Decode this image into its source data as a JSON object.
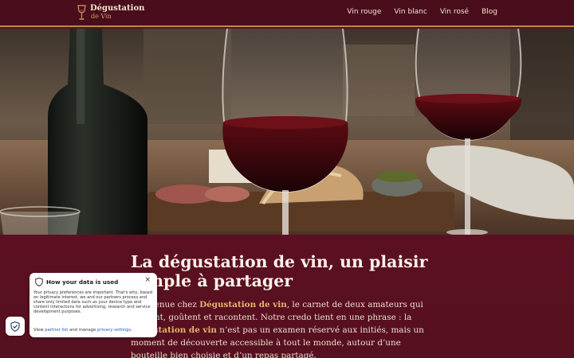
{
  "header": {
    "logo_line1": "Dégustation",
    "logo_line2": "de Vin",
    "nav": [
      {
        "label": "Vin rouge"
      },
      {
        "label": "Vin blanc"
      },
      {
        "label": "Vin rosé"
      },
      {
        "label": "Blog"
      }
    ]
  },
  "hero": {
    "image_icon": "wine-glasses-photo"
  },
  "main": {
    "title": "La dégustation de vin, un plaisir simple à partager",
    "para_prefix": "Bienvenue chez ",
    "para_brand": "Dégustation de vin",
    "para_middle": ", le carnet de deux amateurs qui ouvrent, goûtent et racontent. Notre credo tient en une phrase : la ",
    "para_keyword": "dégustation de vin",
    "para_suffix": " n’est pas un examen réservé aux initiés, mais un moment de découverte accessible à tout le monde, autour d’une bouteille bien choisie et d’un repas partagé."
  },
  "privacy": {
    "title": "How your data is used",
    "close_label": "×",
    "body": "Your privacy preferences are important. That's why, based on legitimate interest, we and our partners process and share only limited data such as your device type and content interactions for advertising, research and service development purposes.",
    "foot_prefix": "View ",
    "partner_link": "partner list",
    "foot_middle": " and manage ",
    "settings_link": "privacy settings",
    "foot_suffix": "."
  },
  "colors": {
    "header_bg": "#4a0d1c",
    "accent_gold": "#c9a063",
    "page_bg": "#5a0f22",
    "link_blue": "#1a57c9"
  }
}
